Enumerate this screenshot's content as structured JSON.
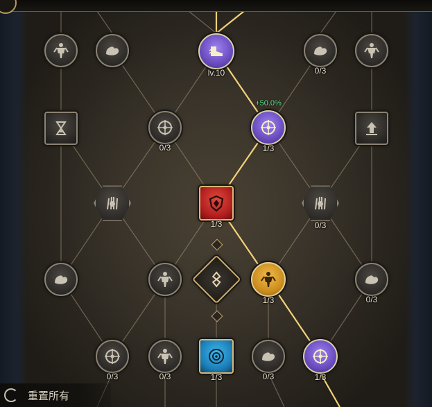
{
  "top": {
    "partial_label": "",
    "partial_count": ""
  },
  "nodes": [
    {
      "id": "n1",
      "kind": "round",
      "style": "gray",
      "icon": "body",
      "label": ""
    },
    {
      "id": "n2",
      "kind": "round",
      "style": "gray",
      "icon": "arm",
      "label": ""
    },
    {
      "id": "n3",
      "kind": "round",
      "style": "purple",
      "icon": "boot",
      "label": "lv.10"
    },
    {
      "id": "n4",
      "kind": "round",
      "style": "gray",
      "icon": "arm",
      "label": "0/3"
    },
    {
      "id": "n5",
      "kind": "round",
      "style": "gray",
      "icon": "body",
      "label": ""
    },
    {
      "id": "n6",
      "kind": "square",
      "style": "gray",
      "icon": "hourglass",
      "label": ""
    },
    {
      "id": "n7",
      "kind": "round",
      "style": "gray",
      "icon": "crosshair",
      "label": "0/3"
    },
    {
      "id": "n8",
      "kind": "round",
      "style": "purple",
      "icon": "crosshair",
      "label": "1/3",
      "bonus": "+50.0%"
    },
    {
      "id": "n9",
      "kind": "square",
      "style": "gray",
      "icon": "upgrade",
      "label": ""
    },
    {
      "id": "n10",
      "kind": "hex",
      "style": "gray",
      "icon": "claw",
      "label": ""
    },
    {
      "id": "n11",
      "kind": "square",
      "style": "red",
      "icon": "shield",
      "label": "1/3"
    },
    {
      "id": "n12",
      "kind": "hex",
      "style": "gray",
      "icon": "claw",
      "label": "0/3"
    },
    {
      "id": "n13",
      "kind": "round",
      "style": "gray",
      "icon": "arm",
      "label": ""
    },
    {
      "id": "n14",
      "kind": "round",
      "style": "gray",
      "icon": "body",
      "label": ""
    },
    {
      "id": "n15",
      "kind": "diamond",
      "style": "core",
      "icon": "core",
      "label": ""
    },
    {
      "id": "n16",
      "kind": "round",
      "style": "gold",
      "icon": "body",
      "label": "1/3"
    },
    {
      "id": "n17",
      "kind": "round",
      "style": "gray",
      "icon": "arm",
      "label": "0/3"
    },
    {
      "id": "n18",
      "kind": "round",
      "style": "gray",
      "icon": "crosshair",
      "label": "0/3"
    },
    {
      "id": "n19",
      "kind": "round",
      "style": "gray",
      "icon": "body",
      "label": "0/3"
    },
    {
      "id": "n20",
      "kind": "square",
      "style": "blue",
      "icon": "target",
      "label": "1/3"
    },
    {
      "id": "n21",
      "kind": "round",
      "style": "gray",
      "icon": "arm",
      "label": "0/3"
    },
    {
      "id": "n22",
      "kind": "round",
      "style": "purple",
      "icon": "crosshair",
      "label": "1/3"
    }
  ],
  "reset": {
    "label": "重置所有"
  },
  "colors": {
    "gold_line": "#f2d27a",
    "dim_line": "#a5977a",
    "purple": "#7b5ccc",
    "red": "#c02626",
    "blue": "#1f8fc9",
    "gold": "#d69a22",
    "bonus_green": "#5ee08a"
  }
}
